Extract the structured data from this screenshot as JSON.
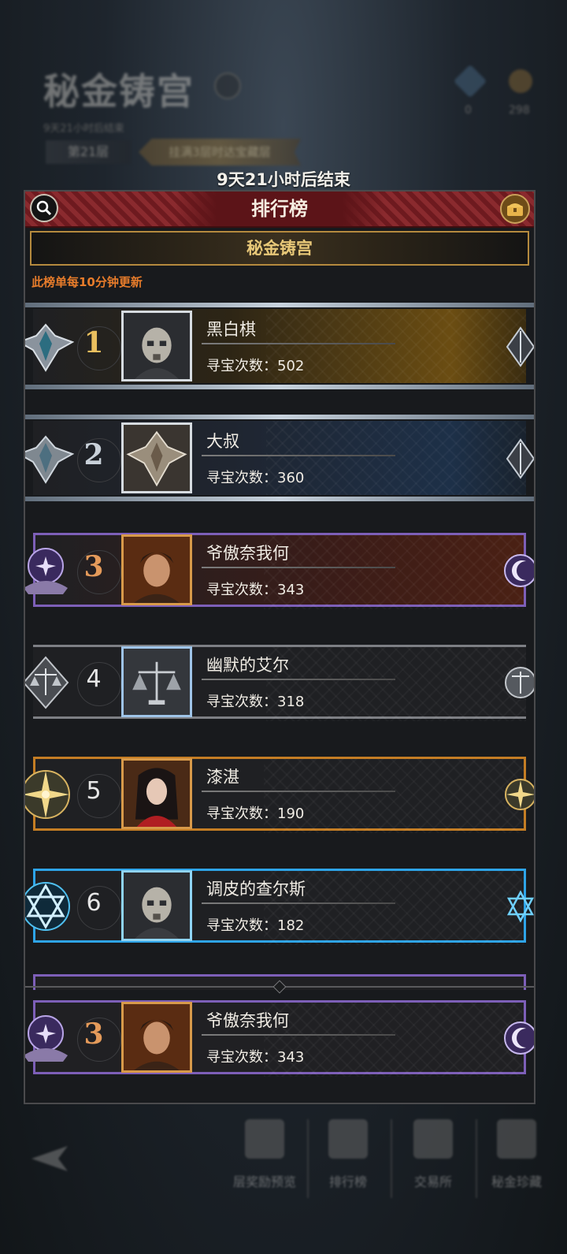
{
  "background": {
    "dungeon_title": "秘金铸宫",
    "subtitle": "9天21小时后结束",
    "floor": "第21层",
    "reward_hint": "挂满3层时达宝藏层",
    "currency_1": "0",
    "currency_2": "298"
  },
  "end_time_text": "9天21小时后结束",
  "leaderboard": {
    "title": "排行榜",
    "sub_title": "秘金铸宫",
    "refresh_note": "此榜单每10分钟更新",
    "score_prefix": "寻宝次数：",
    "entries": [
      {
        "rank": "1",
        "name": "黑白棋",
        "score_text": "寻宝次数：502",
        "frame": "gold"
      },
      {
        "rank": "2",
        "name": "大叔",
        "score_text": "寻宝次数：360",
        "frame": "blue-silver"
      },
      {
        "rank": "3",
        "name": "爷傲奈我何",
        "score_text": "寻宝次数：343",
        "frame": "purple"
      },
      {
        "rank": "4",
        "name": "幽默的艾尔",
        "score_text": "寻宝次数：318",
        "frame": "silver"
      },
      {
        "rank": "5",
        "name": "漆湛",
        "score_text": "寻宝次数：190",
        "frame": "orange"
      },
      {
        "rank": "6",
        "name": "调皮的查尔斯",
        "score_text": "寻宝次数：182",
        "frame": "cyan"
      }
    ],
    "my_entry": {
      "rank": "3",
      "name": "爷傲奈我何",
      "score_text": "寻宝次数：343",
      "frame": "purple"
    }
  },
  "bottom_nav": {
    "items": [
      "层奖励预览",
      "排行榜",
      "交易所",
      "秘金珍藏"
    ]
  },
  "colors": {
    "header_red": "#7a1f24",
    "gold": "#e8c878",
    "note_orange": "#e77c2b",
    "purple": "#7d5fb8",
    "cyan": "#2ea4e8",
    "orange_frame": "#c47d24"
  }
}
